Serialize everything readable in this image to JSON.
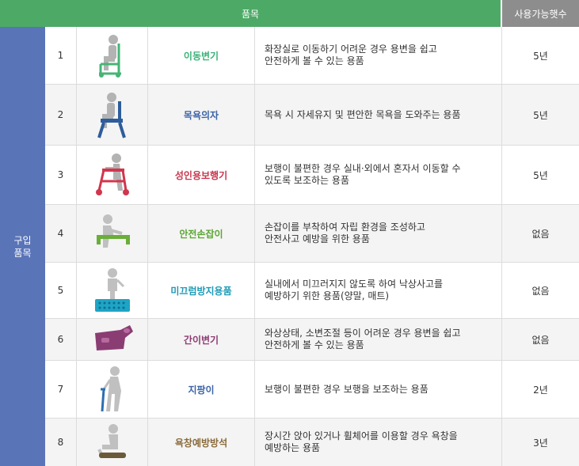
{
  "header": {
    "item_label": "품목",
    "years_label": "사용가능햇수"
  },
  "category": {
    "line1": "구입",
    "line2": "품목"
  },
  "rows": [
    {
      "num": "1",
      "name": "이동변기",
      "name_color": "#3ab277",
      "icon": "commode-chair-icon",
      "desc_line1": "화장실로 이동하기 어려운 경우 용변을 쉽고",
      "desc_line2": "안전하게 볼 수 있는 용품",
      "years": "5년"
    },
    {
      "num": "2",
      "name": "목욕의자",
      "name_color": "#3b64a6",
      "icon": "bath-chair-icon",
      "desc_line1": "목욕 시 자세유지 및 편안한 목욕을 도와주는 용품",
      "desc_line2": "",
      "years": "5년"
    },
    {
      "num": "3",
      "name": "성인용보행기",
      "name_color": "#c8344c",
      "icon": "walker-icon",
      "desc_line1": "보행이 불편한 경우 실내·외에서 혼자서 이동할 수",
      "desc_line2": "있도록 보조하는 용품",
      "years": "5년"
    },
    {
      "num": "4",
      "name": "안전손잡이",
      "name_color": "#5aa632",
      "icon": "safety-handle-icon",
      "desc_line1": "손잡이를 부착하여 자립 환경을 조성하고",
      "desc_line2": "안전사고 예방을 위한 용품",
      "years": "없음"
    },
    {
      "num": "5",
      "name": "미끄럼방지용품",
      "name_color": "#1c9ab6",
      "icon": "anti-slip-mat-icon",
      "desc_line1": "실내에서 미끄러지지 않도록 하여 낙상사고를",
      "desc_line2": "예방하기 위한 용품(양말, 매트)",
      "years": "없음"
    },
    {
      "num": "6",
      "name": "간이변기",
      "name_color": "#8e3b72",
      "icon": "urinal-icon",
      "desc_line1": "와상상태, 소변조절 등이 어려운 경우 용변을 쉽고",
      "desc_line2": "안전하게 볼 수 있는 용품",
      "years": "없음"
    },
    {
      "num": "7",
      "name": "지팡이",
      "name_color": "#3b64a6",
      "icon": "cane-icon",
      "desc_line1": "보행이 불편한 경우 보행을 보조하는 용품",
      "desc_line2": "",
      "years": "2년"
    },
    {
      "num": "8",
      "name": "욕창예방방석",
      "name_color": "#8a6a3a",
      "icon": "cushion-icon",
      "desc_line1": "장시간 앉아 있거나 휠체어를 이용할 경우 욕창을",
      "desc_line2": "예방하는 용품",
      "years": "3년"
    }
  ]
}
